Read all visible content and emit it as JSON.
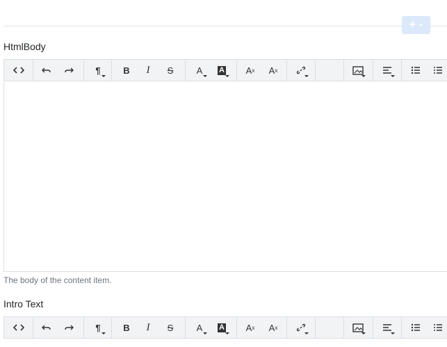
{
  "header": {
    "plus_label": "+",
    "minus_label": "-"
  },
  "fields": [
    {
      "label": "HtmlBody",
      "hint": "The body of the content item."
    },
    {
      "label": "Intro Text"
    }
  ],
  "toolbar_icons": [
    "code-view-icon",
    "undo-icon",
    "redo-icon",
    "paragraph-icon",
    "bold-icon",
    "italic-icon",
    "strikethrough-icon",
    "font-color-icon",
    "highlight-color-icon",
    "superscript-icon",
    "subscript-icon",
    "link-icon",
    "image-icon",
    "align-icon",
    "bullet-list-icon",
    "numbered-list-icon"
  ],
  "colors": {
    "accent_button": "#dbe9fb",
    "toolbar_bg": "#f1f3f5",
    "border": "#dadee2"
  }
}
